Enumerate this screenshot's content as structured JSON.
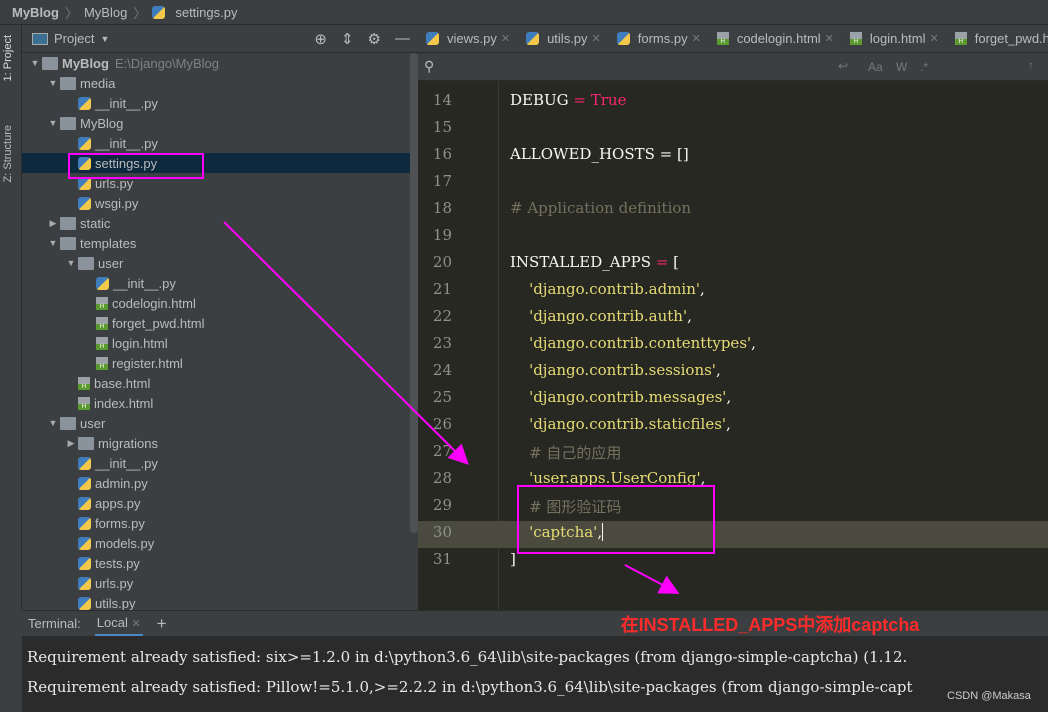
{
  "breadcrumb": [
    "MyBlog",
    "MyBlog",
    "settings.py"
  ],
  "left_tools": [
    "1: Project",
    "Z: Structure"
  ],
  "project_panel": {
    "title": "Project",
    "root_path": "E:\\Django\\MyBlog"
  },
  "tree": [
    {
      "label": "MyBlog",
      "depth": 0,
      "type": "folder",
      "open": true,
      "bold": true
    },
    {
      "label": "media",
      "depth": 1,
      "type": "folder",
      "open": true
    },
    {
      "label": "__init__.py",
      "depth": 2,
      "type": "py"
    },
    {
      "label": "MyBlog",
      "depth": 1,
      "type": "folder",
      "open": true
    },
    {
      "label": "__init__.py",
      "depth": 2,
      "type": "py"
    },
    {
      "label": "settings.py",
      "depth": 2,
      "type": "py",
      "selected": true
    },
    {
      "label": "urls.py",
      "depth": 2,
      "type": "py"
    },
    {
      "label": "wsgi.py",
      "depth": 2,
      "type": "py"
    },
    {
      "label": "static",
      "depth": 1,
      "type": "folder",
      "open": false
    },
    {
      "label": "templates",
      "depth": 1,
      "type": "folder",
      "open": true
    },
    {
      "label": "user",
      "depth": 2,
      "type": "folder",
      "open": true
    },
    {
      "label": "__init__.py",
      "depth": 3,
      "type": "py"
    },
    {
      "label": "codelogin.html",
      "depth": 3,
      "type": "html"
    },
    {
      "label": "forget_pwd.html",
      "depth": 3,
      "type": "html"
    },
    {
      "label": "login.html",
      "depth": 3,
      "type": "html"
    },
    {
      "label": "register.html",
      "depth": 3,
      "type": "html"
    },
    {
      "label": "base.html",
      "depth": 2,
      "type": "html"
    },
    {
      "label": "index.html",
      "depth": 2,
      "type": "html"
    },
    {
      "label": "user",
      "depth": 1,
      "type": "folder",
      "open": true
    },
    {
      "label": "migrations",
      "depth": 2,
      "type": "folder",
      "open": false
    },
    {
      "label": "__init__.py",
      "depth": 2,
      "type": "py"
    },
    {
      "label": "admin.py",
      "depth": 2,
      "type": "py"
    },
    {
      "label": "apps.py",
      "depth": 2,
      "type": "py"
    },
    {
      "label": "forms.py",
      "depth": 2,
      "type": "py"
    },
    {
      "label": "models.py",
      "depth": 2,
      "type": "py"
    },
    {
      "label": "tests.py",
      "depth": 2,
      "type": "py"
    },
    {
      "label": "urls.py",
      "depth": 2,
      "type": "py"
    },
    {
      "label": "utils.py",
      "depth": 2,
      "type": "py"
    }
  ],
  "tabs": [
    {
      "label": "views.py",
      "type": "py"
    },
    {
      "label": "utils.py",
      "type": "py"
    },
    {
      "label": "forms.py",
      "type": "py"
    },
    {
      "label": "codelogin.html",
      "type": "html"
    },
    {
      "label": "login.html",
      "type": "html"
    },
    {
      "label": "forget_pwd.html",
      "type": "html"
    }
  ],
  "search": {
    "options": [
      "Aa",
      "W",
      ".*"
    ]
  },
  "code": [
    {
      "n": "14",
      "parts": [
        [
          "DEBUG ",
          ""
        ],
        [
          "= ",
          "k"
        ],
        [
          "True",
          "k"
        ]
      ]
    },
    {
      "n": "15",
      "parts": []
    },
    {
      "n": "16",
      "parts": [
        [
          "ALLOWED_HOSTS = []",
          ""
        ]
      ]
    },
    {
      "n": "17",
      "parts": []
    },
    {
      "n": "18",
      "parts": [
        [
          "# Application definition",
          "c"
        ]
      ]
    },
    {
      "n": "19",
      "parts": []
    },
    {
      "n": "20",
      "parts": [
        [
          "INSTALLED_APPS ",
          ""
        ],
        [
          "= ",
          "k"
        ],
        [
          "[",
          ""
        ]
      ]
    },
    {
      "n": "21",
      "parts": [
        [
          "    'django.contrib.admin'",
          "s"
        ],
        [
          ",",
          ""
        ]
      ]
    },
    {
      "n": "22",
      "parts": [
        [
          "    'django.contrib.auth'",
          "s"
        ],
        [
          ",",
          ""
        ]
      ]
    },
    {
      "n": "23",
      "parts": [
        [
          "    'django.contrib.contenttypes'",
          "s"
        ],
        [
          ",",
          ""
        ]
      ]
    },
    {
      "n": "24",
      "parts": [
        [
          "    'django.contrib.sessions'",
          "s"
        ],
        [
          ",",
          ""
        ]
      ]
    },
    {
      "n": "25",
      "parts": [
        [
          "    'django.contrib.messages'",
          "s"
        ],
        [
          ",",
          ""
        ]
      ]
    },
    {
      "n": "26",
      "parts": [
        [
          "    'django.contrib.staticfiles'",
          "s"
        ],
        [
          ",",
          ""
        ]
      ]
    },
    {
      "n": "27",
      "parts": [
        [
          "    # 自己的应用",
          "c"
        ]
      ]
    },
    {
      "n": "28",
      "parts": [
        [
          "    'user.apps.UserConfig'",
          "s"
        ],
        [
          ",",
          ""
        ]
      ]
    },
    {
      "n": "29",
      "parts": [
        [
          "    # 图形验证码",
          "c"
        ]
      ]
    },
    {
      "n": "30",
      "parts": [
        [
          "    'captcha'",
          "s"
        ],
        [
          ",",
          ""
        ]
      ],
      "current": true
    },
    {
      "n": "31",
      "parts": [
        [
          "]",
          ""
        ]
      ]
    }
  ],
  "terminal": {
    "label": "Terminal:",
    "tab": "Local",
    "lines": [
      "Requirement already satisfied: six>=1.2.0 in d:\\python3.6_64\\lib\\site-packages (from django-simple-captcha) (1.12.",
      "Requirement already satisfied: Pillow!=5.1.0,>=2.2.2 in d:\\python3.6_64\\lib\\site-packages (from django-simple-capt"
    ]
  },
  "annotation": {
    "text": "在INSTALLED_APPS中添加captcha",
    "color": "#ff00ff"
  },
  "watermark": "CSDN @Makasa"
}
